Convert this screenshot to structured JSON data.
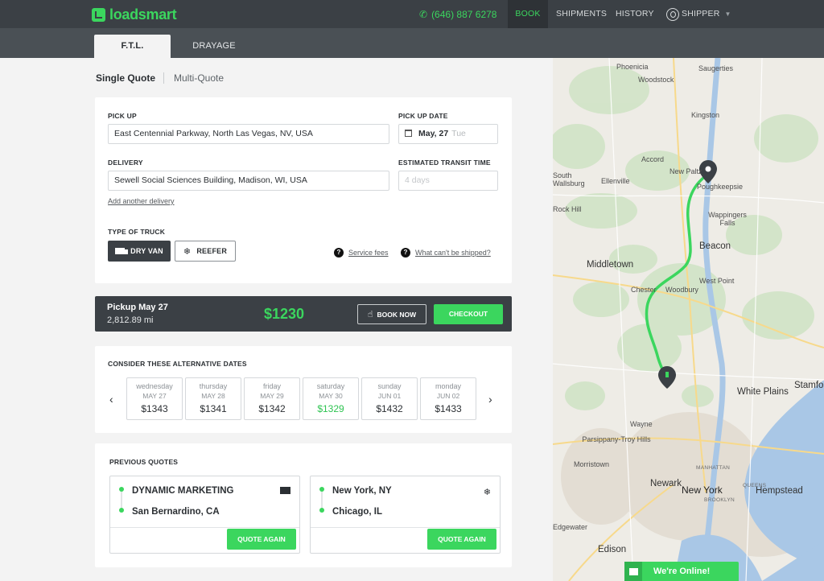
{
  "header": {
    "brand": "loadsmart",
    "phone": "(646) 887 6278",
    "nav": [
      "BOOK",
      "SHIPMENTS",
      "HISTORY"
    ],
    "user": "SHIPPER"
  },
  "tabs": [
    "F.T.L.",
    "DRAYAGE"
  ],
  "quote_mode": {
    "single": "Single Quote",
    "multi": "Multi-Quote"
  },
  "form": {
    "pickup_label": "PICK UP",
    "pickup_value": "East Centennial Parkway, North Las Vegas, NV, USA",
    "pickup_date_label": "PICK UP DATE",
    "pickup_date_day": "May, 27",
    "pickup_date_weekday": "Tue",
    "delivery_label": "DELIVERY",
    "delivery_value": "Sewell Social Sciences Building, Madison, WI, USA",
    "transit_label": "ESTIMATED TRANSIT TIME",
    "transit_placeholder": "4 days",
    "add_delivery": "Add another delivery",
    "truck_type_label": "TYPE OF TRUCK",
    "truck_types": [
      "DRY VAN",
      "REEFER"
    ],
    "service_fees": "Service fees",
    "cant_ship": "What can't be shipped?"
  },
  "summary": {
    "pickup": "Pickup May 27",
    "distance": "2,812.89 mi",
    "price": "$1230",
    "book_now": "BOOK NOW",
    "checkout": "CHECKOUT"
  },
  "alt_dates": {
    "title": "CONSIDER THESE ALTERNATIVE DATES",
    "days": [
      {
        "weekday": "wednesday",
        "date": "MAY 27",
        "price": "$1343"
      },
      {
        "weekday": "thursday",
        "date": "MAY 28",
        "price": "$1341"
      },
      {
        "weekday": "friday",
        "date": "MAY 29",
        "price": "$1342"
      },
      {
        "weekday": "saturday",
        "date": "MAY 30",
        "price": "$1329"
      },
      {
        "weekday": "sunday",
        "date": "JUN 01",
        "price": "$1432"
      },
      {
        "weekday": "monday",
        "date": "JUN 02",
        "price": "$1433"
      }
    ]
  },
  "previous_quotes": {
    "title": "PREVIOUS QUOTES",
    "items": [
      {
        "from": "DYNAMIC MARKETING",
        "to": "San Bernardino, CA",
        "truck": "truck-icon",
        "action": "QUOTE AGAIN"
      },
      {
        "from": "New York, NY",
        "to": "Chicago, IL",
        "truck": "snowflake-icon",
        "action": "QUOTE AGAIN"
      }
    ]
  },
  "map": {
    "labels": [
      "Phoenicia",
      "Saugerties",
      "Woodstock",
      "Kingston",
      "Accord",
      "New Paltz",
      "Poughkeepsie",
      "South Wallsburg",
      "Ellenville",
      "Rock Hill",
      "Wappingers Falls",
      "Beacon",
      "Middletown",
      "Chester",
      "Woodbury",
      "West Point",
      "White Plains",
      "Stamford",
      "Wayne",
      "Parsippany-Troy Hills",
      "Morristown",
      "MANHATTAN",
      "Newark",
      "QUEENS",
      "New York",
      "BROOKLYN",
      "Hempstead",
      "Edgewater",
      "Edison"
    ]
  },
  "chat": "We're Online!"
}
